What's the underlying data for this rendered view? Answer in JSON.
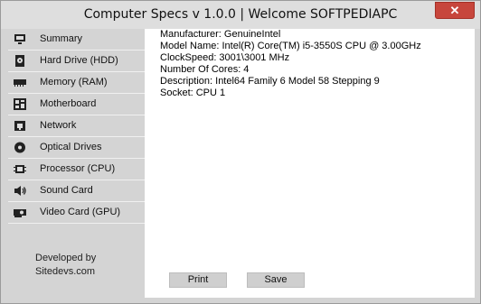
{
  "window": {
    "title": "Computer Specs v 1.0.0  |  Welcome SOFTPEDIAPC",
    "close_label": "✕"
  },
  "sidebar": {
    "items": [
      {
        "label": "Summary",
        "icon": "monitor-icon"
      },
      {
        "label": "Hard Drive (HDD)",
        "icon": "hard-drive-icon"
      },
      {
        "label": "Memory (RAM)",
        "icon": "memory-icon"
      },
      {
        "label": "Motherboard",
        "icon": "motherboard-icon"
      },
      {
        "label": "Network",
        "icon": "network-icon"
      },
      {
        "label": "Optical Drives",
        "icon": "disc-icon"
      },
      {
        "label": "Processor (CPU)",
        "icon": "cpu-icon",
        "active": true
      },
      {
        "label": "Sound Card",
        "icon": "speaker-icon"
      },
      {
        "label": "Video Card (GPU)",
        "icon": "video-card-icon"
      }
    ],
    "credits_line1": "Developed by",
    "credits_line2": "Sitedevs.com"
  },
  "details": {
    "manufacturer": "Manufacturer: GenuineIntel",
    "model_name": "Model Name: Intel(R) Core(TM) i5-3550S CPU @ 3.00GHz",
    "clock_speed": "ClockSpeed: 3001\\3001 MHz",
    "cores": "Number Of Cores: 4",
    "description": "Description: Intel64 Family 6 Model 58 Stepping 9",
    "socket": "Socket: CPU 1"
  },
  "buttons": {
    "print": "Print",
    "save": "Save"
  },
  "colors": {
    "close_button": "#c7463c",
    "sidebar_bg": "#d4d4d4",
    "content_bg": "#ffffff"
  }
}
